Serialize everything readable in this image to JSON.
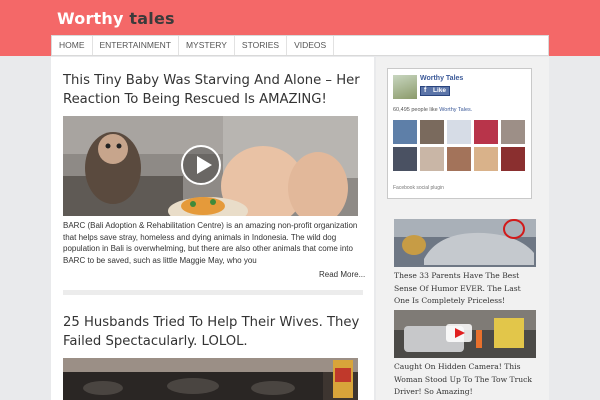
{
  "site": {
    "logo_first": "Worthy",
    "logo_second": " tales"
  },
  "nav": {
    "items": [
      "HOME",
      "ENTERTAINMENT",
      "MYSTERY",
      "STORIES",
      "VIDEOS"
    ]
  },
  "posts": [
    {
      "title": "This Tiny Baby Was Starving And Alone – Her Reaction To Being Rescued Is AMAZING!",
      "excerpt": "BARC (Bali Adoption & Rehabilitation Centre) is an amazing non-profit organization that helps save stray, homeless and dying animals in Indonesia. The wild dog population in Bali is overwhelming, but there are also other animals that come into BARC to be saved, such as little Maggie May, who you",
      "read_more": "Read More..."
    },
    {
      "title": "25 Husbands Tried To Help Their Wives. They Failed Spectacularly. LOLOL."
    }
  ],
  "facebook": {
    "page_name": "Worthy Tales",
    "like_label": "Like",
    "count_number": "60,495",
    "count_text": " people like ",
    "count_page": "Worthy Tales.",
    "plugin_label": "Facebook social plugin"
  },
  "sidebar_posts": [
    {
      "caption": "These 33 Parents Have The Best Sense Of Humor EVER. The Last One Is Completely Priceless!"
    },
    {
      "caption": "Caught On Hidden Camera! This Woman Stood Up To The Tow Truck Driver! So Amazing!"
    }
  ],
  "colors": {
    "brand": "#f46868",
    "facebook": "#3b5998"
  }
}
